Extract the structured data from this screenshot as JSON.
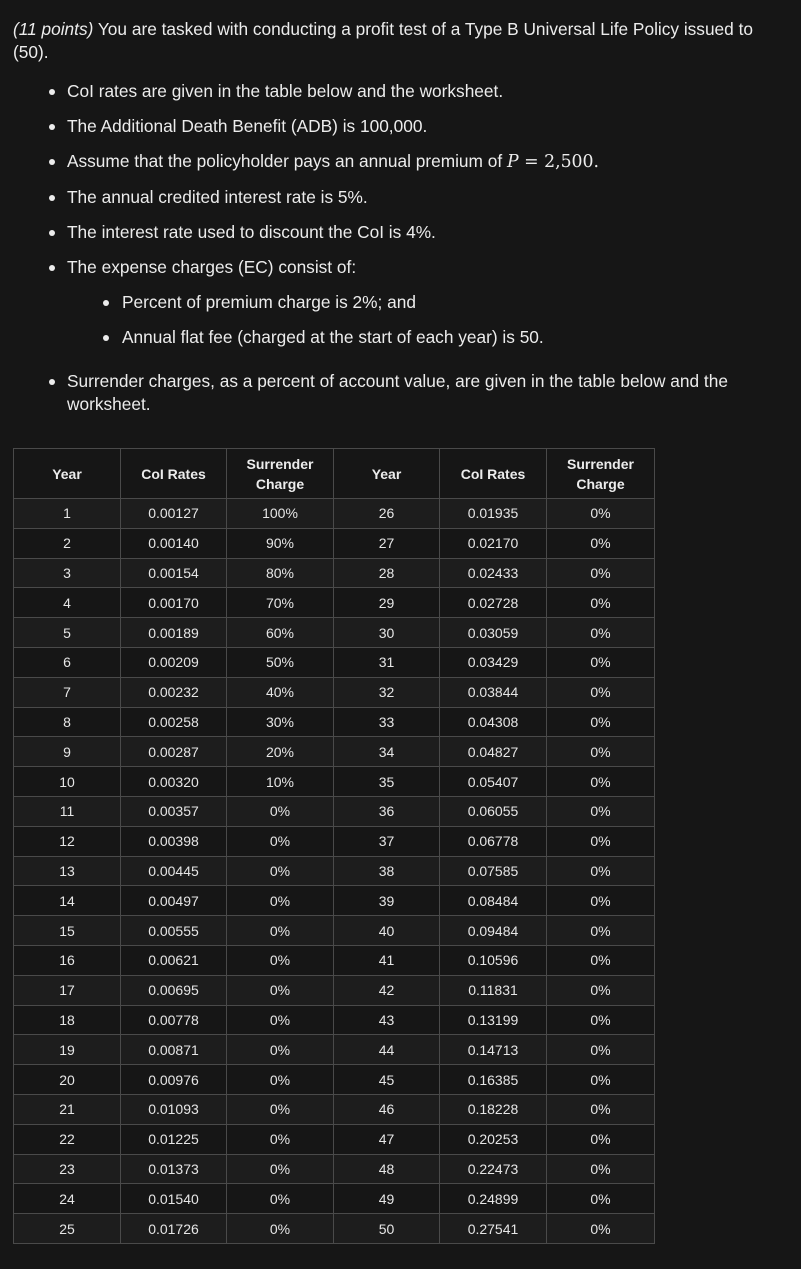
{
  "intro": {
    "points": "(11 points)",
    "text": " You are tasked with conducting a profit test of a Type B Universal Life Policy issued to (50)."
  },
  "bullets": {
    "coi": "CoI rates are given in the table below and the worksheet.",
    "adb": "The Additional Death Benefit (ADB) is 100,000.",
    "premium_prefix": "Assume that the policyholder pays an annual premium of ",
    "premium_var": "P",
    "premium_eq": " = 2,500.",
    "credited": "The annual credited interest rate is 5%.",
    "discount": "The interest rate used to discount the CoI is 4%.",
    "expense": "The expense charges (EC) consist of:",
    "expense_sub": [
      "Percent of premium charge is 2%; and",
      "Annual flat fee (charged at the start of each year) is 50."
    ],
    "surrender": "Surrender charges, as a percent of account value, are given in the table below and the worksheet."
  },
  "table": {
    "headers": [
      "Year",
      "CoI Rates",
      "Surrender Charge",
      "Year",
      "CoI Rates",
      "Surrender Charge"
    ],
    "rows": [
      [
        "1",
        "0.00127",
        "100%",
        "26",
        "0.01935",
        "0%"
      ],
      [
        "2",
        "0.00140",
        "90%",
        "27",
        "0.02170",
        "0%"
      ],
      [
        "3",
        "0.00154",
        "80%",
        "28",
        "0.02433",
        "0%"
      ],
      [
        "4",
        "0.00170",
        "70%",
        "29",
        "0.02728",
        "0%"
      ],
      [
        "5",
        "0.00189",
        "60%",
        "30",
        "0.03059",
        "0%"
      ],
      [
        "6",
        "0.00209",
        "50%",
        "31",
        "0.03429",
        "0%"
      ],
      [
        "7",
        "0.00232",
        "40%",
        "32",
        "0.03844",
        "0%"
      ],
      [
        "8",
        "0.00258",
        "30%",
        "33",
        "0.04308",
        "0%"
      ],
      [
        "9",
        "0.00287",
        "20%",
        "34",
        "0.04827",
        "0%"
      ],
      [
        "10",
        "0.00320",
        "10%",
        "35",
        "0.05407",
        "0%"
      ],
      [
        "11",
        "0.00357",
        "0%",
        "36",
        "0.06055",
        "0%"
      ],
      [
        "12",
        "0.00398",
        "0%",
        "37",
        "0.06778",
        "0%"
      ],
      [
        "13",
        "0.00445",
        "0%",
        "38",
        "0.07585",
        "0%"
      ],
      [
        "14",
        "0.00497",
        "0%",
        "39",
        "0.08484",
        "0%"
      ],
      [
        "15",
        "0.00555",
        "0%",
        "40",
        "0.09484",
        "0%"
      ],
      [
        "16",
        "0.00621",
        "0%",
        "41",
        "0.10596",
        "0%"
      ],
      [
        "17",
        "0.00695",
        "0%",
        "42",
        "0.11831",
        "0%"
      ],
      [
        "18",
        "0.00778",
        "0%",
        "43",
        "0.13199",
        "0%"
      ],
      [
        "19",
        "0.00871",
        "0%",
        "44",
        "0.14713",
        "0%"
      ],
      [
        "20",
        "0.00976",
        "0%",
        "45",
        "0.16385",
        "0%"
      ],
      [
        "21",
        "0.01093",
        "0%",
        "46",
        "0.18228",
        "0%"
      ],
      [
        "22",
        "0.01225",
        "0%",
        "47",
        "0.20253",
        "0%"
      ],
      [
        "23",
        "0.01373",
        "0%",
        "48",
        "0.22473",
        "0%"
      ],
      [
        "24",
        "0.01540",
        "0%",
        "49",
        "0.24899",
        "0%"
      ],
      [
        "25",
        "0.01726",
        "0%",
        "50",
        "0.27541",
        "0%"
      ]
    ]
  }
}
